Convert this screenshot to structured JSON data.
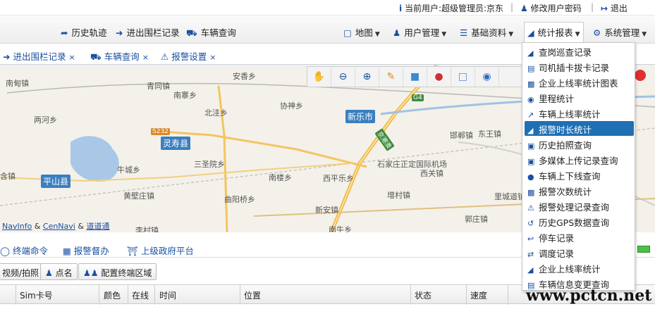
{
  "topbar": {
    "current_user": "当前用户:超级管理员:京东",
    "change_password": "修改用户密码",
    "logout": "退出"
  },
  "nav": {
    "history_track": "历史轨迹",
    "fence_record": "进出围栏记录",
    "vehicle_query": "车辆查询",
    "map": "地图",
    "user_mgmt": "用户管理",
    "base_data": "基础资料",
    "stats_report": "统计报表",
    "system_mgmt": "系统管理"
  },
  "tabs": [
    {
      "label": "进出围栏记录"
    },
    {
      "label": "车辆查询"
    },
    {
      "label": "报警设置"
    }
  ],
  "map": {
    "labels": {
      "nanshe": "南甸镇",
      "qingliu": "青同镇",
      "nanzhai": "南寨乡",
      "anxiang": "安香乡",
      "beiliang": "北洼乡",
      "xiehe": "协神乡",
      "xinle": "新乐市",
      "handan": "邯郸镇",
      "dongwang": "东王镇",
      "lingshou": "灵寿县",
      "sansheng": "三圣院乡",
      "niucheng": "牛城乡",
      "pingshan": "平山县",
      "huangbi": "黄壁庄镇",
      "nanlou": "南楼乡",
      "xiping": "西平乐乡",
      "airport": "石家庄正定国际机场",
      "xiguan": "西关镇",
      "qucheng": "曲阳桥乡",
      "zengcun": "增村镇",
      "xinan": "新安镇",
      "licun": "李村镇",
      "nanniu": "南牛乡",
      "guozhuang": "郭庄镇",
      "licheng": "里城道镇",
      "liangxi": "两河乡",
      "chengzhen": "含镇",
      "s232": "S232",
      "g4": "G4",
      "jinggang": "京港澳"
    },
    "attribution": [
      "NavInfo",
      "CenNavi",
      "道道通"
    ]
  },
  "panel_tabs": [
    "终端命令",
    "报警督办",
    "上级政府平台"
  ],
  "toolbar2": {
    "video": "视频/拍照",
    "rollcall": "点名",
    "config_area": "配置终端区域"
  },
  "grid_columns": [
    "Sim卡号",
    "颜色",
    "在线",
    "时间",
    "位置",
    "状态",
    "速度"
  ],
  "dropdown": {
    "items": [
      {
        "label": "查岗巡查记录",
        "icon": "area-chart-icon"
      },
      {
        "label": "司机插卡拔卡记录",
        "icon": "card-icon"
      },
      {
        "label": "企业上线率统计图表",
        "icon": "bar-chart-icon"
      },
      {
        "label": "里程统计",
        "icon": "dashboard-icon"
      },
      {
        "label": "车辆上线率统计",
        "icon": "line-chart-icon"
      },
      {
        "label": "报警时长统计",
        "icon": "area-chart-icon"
      },
      {
        "label": "历史拍照查询",
        "icon": "picture-icon"
      },
      {
        "label": "多媒体上传记录查询",
        "icon": "picture-icon"
      },
      {
        "label": "车辆上下线查询",
        "icon": "comment-icon"
      },
      {
        "label": "报警次数统计",
        "icon": "bar-chart-icon"
      },
      {
        "label": "报警处理记录查询",
        "icon": "warning-icon"
      },
      {
        "label": "历史GPS数据查询",
        "icon": "history-icon"
      },
      {
        "label": "停车记录",
        "icon": "reply-icon"
      },
      {
        "label": "调度记录",
        "icon": "random-icon"
      },
      {
        "label": "企业上线率统计",
        "icon": "area-chart-icon"
      },
      {
        "label": "车辆信息变更查询",
        "icon": "file-icon"
      }
    ],
    "highlighted_index": 5
  },
  "watermark": "www.pctcn.net"
}
